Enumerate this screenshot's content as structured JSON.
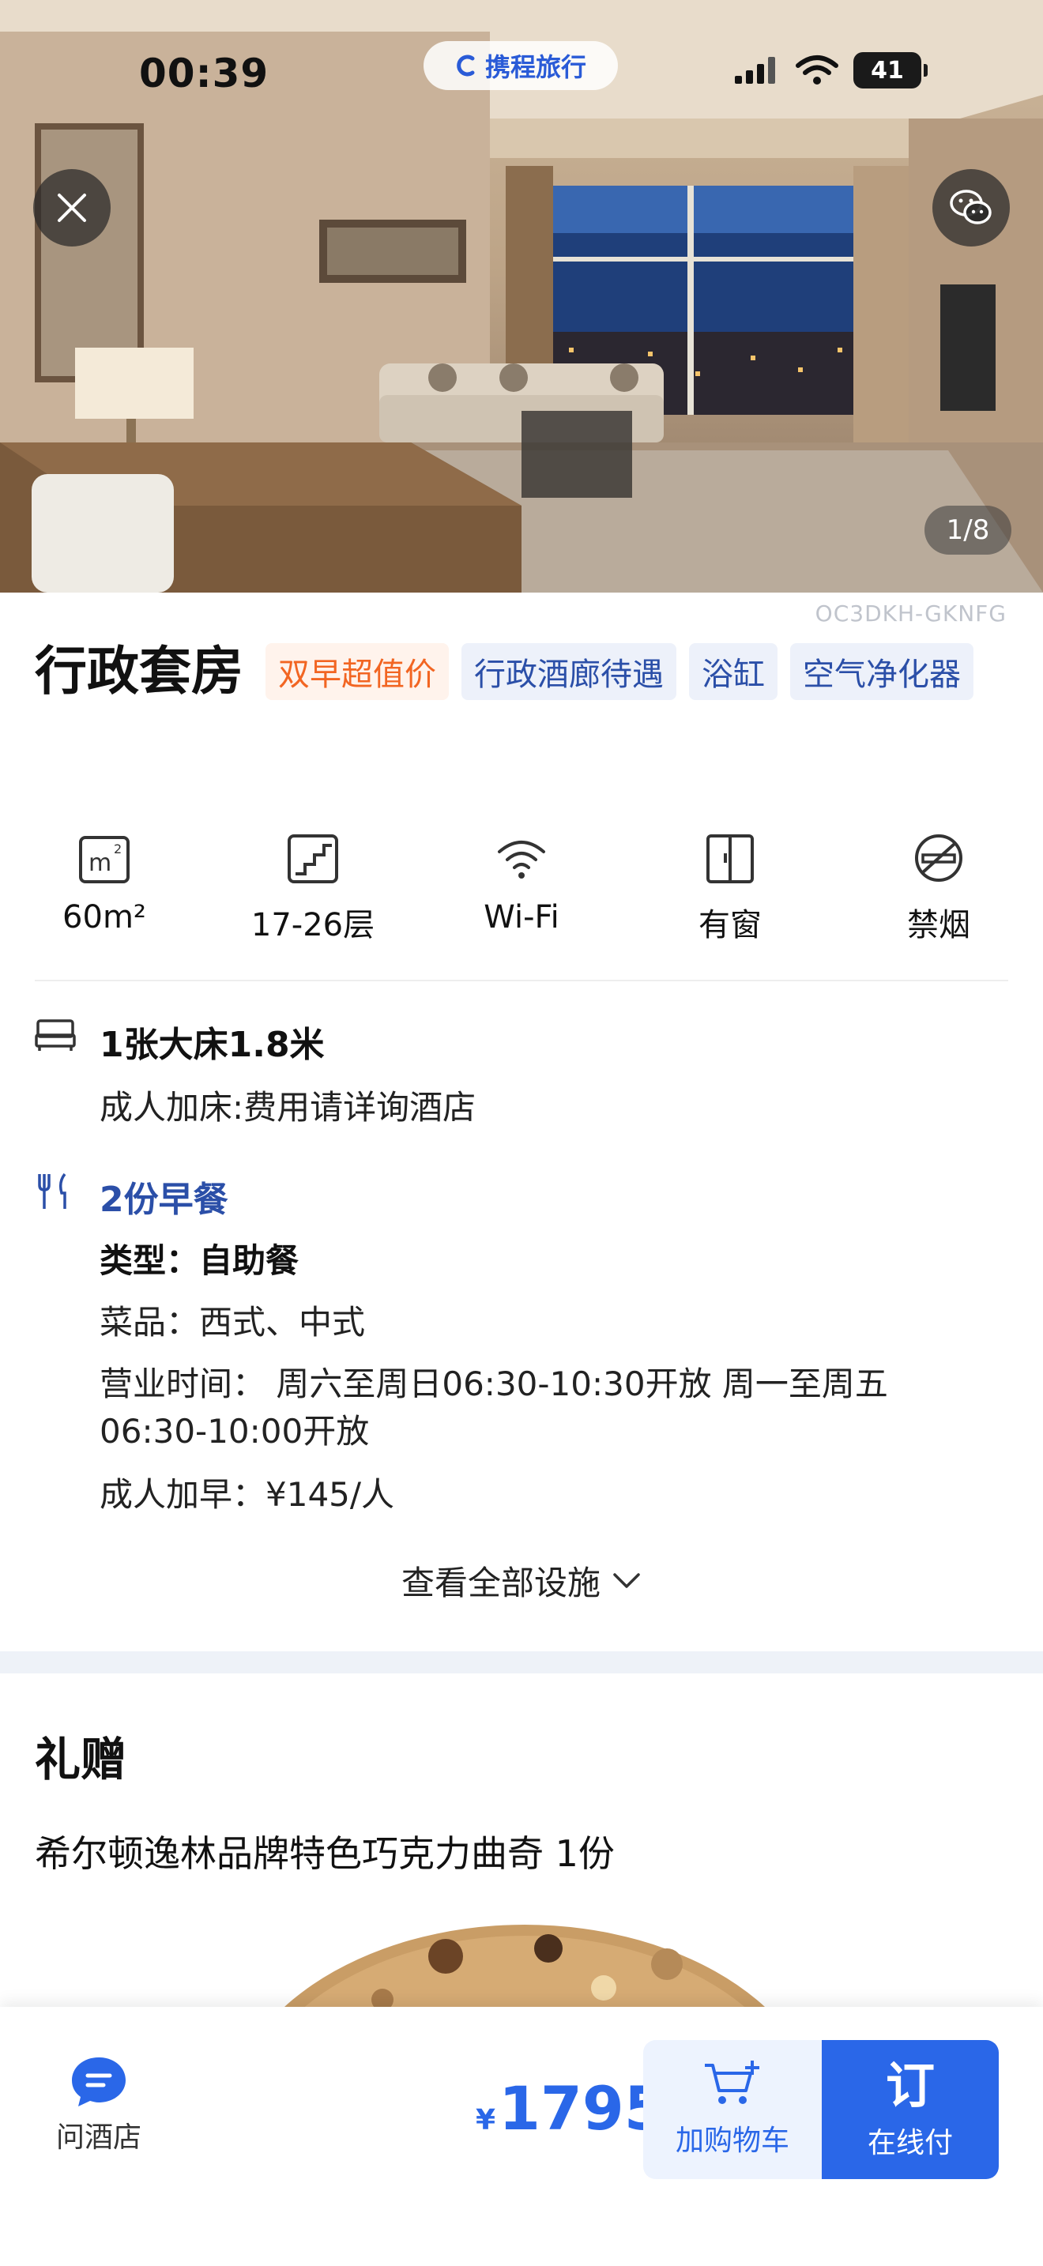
{
  "status_bar": {
    "time": "00:39",
    "brand": "携程旅行",
    "battery": "41"
  },
  "hero": {
    "counter": "1/8",
    "room_code": "OC3DKH-GKNFG"
  },
  "room": {
    "title": "行政套房",
    "tags": [
      {
        "label": "双早超值价",
        "color": "#f26522"
      },
      {
        "label": "行政酒廊待遇",
        "color": "#2b4fa8"
      },
      {
        "label": "浴缸",
        "color": "#2b4fa8"
      },
      {
        "label": "空气净化器",
        "color": "#2b4fa8"
      }
    ]
  },
  "amenities": [
    {
      "icon": "area-icon",
      "label": "60m²"
    },
    {
      "icon": "stairs-icon",
      "label": "17-26层"
    },
    {
      "icon": "wifi-icon",
      "label": "Wi-Fi"
    },
    {
      "icon": "window-icon",
      "label": "有窗"
    },
    {
      "icon": "no-smoking-icon",
      "label": "禁烟"
    }
  ],
  "bed": {
    "icon": "bed-icon",
    "title": "1张大床1.8米",
    "extra": "成人加床:费用请详询酒店"
  },
  "breakfast": {
    "icon": "cutlery-icon",
    "title": "2份早餐",
    "type": "类型：自助餐",
    "dishes": "菜品：西式、中式",
    "hours_line1": "营业时间： 周六至周日06:30-10:30开放 周一至周五",
    "hours_line2": "06:30-10:00开放",
    "extra": "成人加早：¥145/人"
  },
  "view_all": "查看全部设施",
  "gift": {
    "heading": "礼赠",
    "item": "希尔顿逸林品牌特色巧克力曲奇 1份"
  },
  "bottom_bar": {
    "ask_label": "问酒店",
    "currency": "¥",
    "price": "1795",
    "cart_label": "加购物车",
    "book_big": "订",
    "book_label": "在线付",
    "accent": "#2a67e8"
  }
}
